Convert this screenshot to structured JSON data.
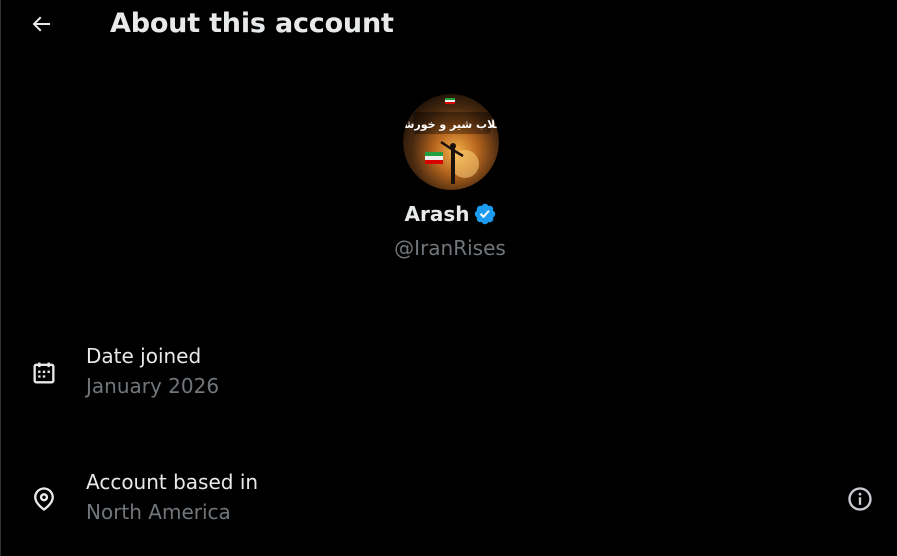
{
  "header": {
    "title": "About this account",
    "back_icon": "arrow-left-icon"
  },
  "profile": {
    "display_name": "Arash",
    "handle": "@IranRises",
    "verified": true,
    "verified_color": "#1d9bf0",
    "avatar_text": "انقلاب شیر و خورشید"
  },
  "details": [
    {
      "icon": "calendar-icon",
      "label": "Date joined",
      "value": "January 2026"
    },
    {
      "icon": "location-pin-icon",
      "label": "Account based in",
      "value": "North America",
      "info_icon": "info-icon"
    }
  ],
  "colors": {
    "background": "#000000",
    "primary_text": "#e7e9ea",
    "secondary_text": "#71767b",
    "accent": "#1d9bf0"
  }
}
